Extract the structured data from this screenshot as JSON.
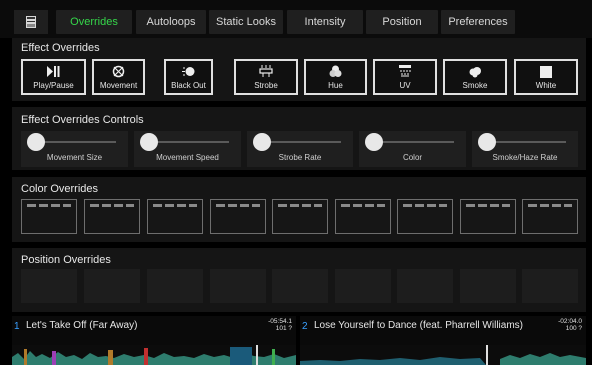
{
  "tabs": [
    {
      "label": "Overrides",
      "active": true
    },
    {
      "label": "Autoloops"
    },
    {
      "label": "Static Looks"
    },
    {
      "label": "Intensity"
    },
    {
      "label": "Position"
    },
    {
      "label": "Preferences"
    }
  ],
  "effect_overrides": {
    "title": "Effect Overrides",
    "buttons": [
      {
        "label": "Play/Pause",
        "icon": "play-pause-icon"
      },
      {
        "label": "Movement",
        "icon": "movement-icon"
      },
      {
        "label": "Black Out",
        "icon": "blackout-icon"
      },
      {
        "label": "Strobe",
        "icon": "strobe-icon"
      },
      {
        "label": "Hue",
        "icon": "hue-icon"
      },
      {
        "label": "UV",
        "icon": "uv-icon"
      },
      {
        "label": "Smoke",
        "icon": "smoke-icon"
      },
      {
        "label": "White",
        "icon": "white-icon"
      }
    ]
  },
  "effect_controls": {
    "title": "Effect Overrides Controls",
    "sliders": [
      {
        "label": "Movement Size"
      },
      {
        "label": "Movement Speed"
      },
      {
        "label": "Strobe Rate"
      },
      {
        "label": "Color"
      },
      {
        "label": "Smoke/Haze Rate"
      }
    ]
  },
  "color_overrides": {
    "title": "Color Overrides",
    "slot_count": 9
  },
  "position_overrides": {
    "title": "Position Overrides",
    "slot_count": 9
  },
  "decks": [
    {
      "number": "1",
      "title": "Let's Take Off (Far Away)",
      "time": "-05:54.1",
      "bpm": "101 ?"
    },
    {
      "number": "2",
      "title": "Lose Yourself to Dance (feat. Pharrell Williams)",
      "time": "-02:04.0",
      "bpm": "100 ?"
    }
  ],
  "colors": {
    "accent": "#35d64a",
    "deck_number": "#3aa0ff"
  }
}
